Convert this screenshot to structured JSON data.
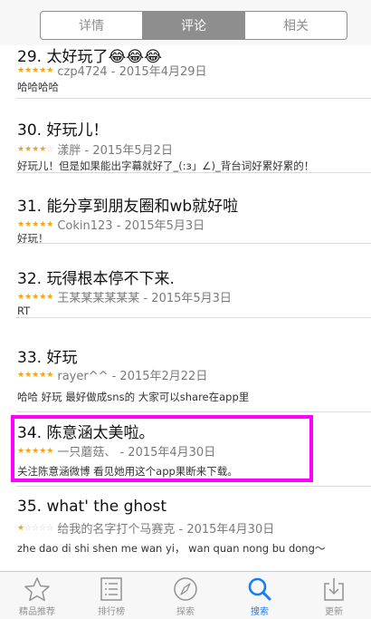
{
  "segments": [
    {
      "label": "详情",
      "active": false
    },
    {
      "label": "评论",
      "active": true
    },
    {
      "label": "相关",
      "active": false
    }
  ],
  "reviews": [
    {
      "title": "29. 太好玩了😂😂😂",
      "stars": "★★★★★",
      "stars_off": "",
      "author_date": "czp4724 - 2015年4月29日",
      "body": "哈哈哈哈"
    },
    {
      "title": "30. 好玩儿！",
      "stars": "★★★★",
      "stars_off": "☆",
      "author_date": "漾胖 - 2015年5月2日",
      "body": "好玩儿！但是如果能出字幕就好了_(:з」∠)_背台词好累好累的！"
    },
    {
      "title": "31. 能分享到朋友圈和wb就好啦",
      "stars": "★★★★★",
      "stars_off": "",
      "author_date": "Cokin123 - 2015年5月3日",
      "body": "好玩！"
    },
    {
      "title": "32. 玩得根本停不下来.",
      "stars": "★★★★★",
      "stars_off": "",
      "author_date": "王某某某某某某 - 2015年5月3日",
      "body": "RT"
    },
    {
      "title": "33. 好玩",
      "stars": "★★★★★",
      "stars_off": "",
      "author_date": "rayer^^ - 2015年2月22日",
      "body": "哈哈  好玩  最好做成sns的  大家可以share在app里"
    },
    {
      "title": "34. 陈意涵太美啦。",
      "stars": "★★★★★",
      "stars_off": "",
      "author_date": "一只蘑菇、 - 2015年4月30日",
      "body": "关注陈意涵微博 看见她用这个app果断来下载。"
    },
    {
      "title": "35. what' the ghost",
      "stars": "★",
      "stars_off": "☆☆☆☆",
      "author_date": "给我的名字打个马赛克 - 2015年4月30日",
      "body": "zhe dao di shi shen me wan yi， wan quan nong bu dong～"
    }
  ],
  "tabbar": [
    {
      "label": "精品推荐",
      "icon": "star-icon",
      "active": false
    },
    {
      "label": "排行榜",
      "icon": "list-icon",
      "active": false
    },
    {
      "label": "探索",
      "icon": "compass-icon",
      "active": false
    },
    {
      "label": "搜索",
      "icon": "search-icon",
      "active": true
    },
    {
      "label": "更新",
      "icon": "update-icon",
      "active": false
    }
  ],
  "colors": {
    "star": "#f4a11d",
    "accent": "#1a7cf5",
    "highlight": "#ff00ff"
  }
}
